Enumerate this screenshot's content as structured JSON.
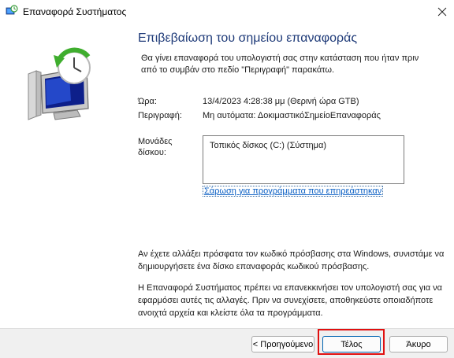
{
  "window": {
    "title": "Επαναφορά Συστήματος",
    "icon": "system-restore-icon",
    "close_glyph": "✕"
  },
  "main": {
    "heading": "Επιβεβαίωση του σημείου επαναφοράς",
    "intro": "Θα γίνει επαναφορά του υπολογιστή σας στην κατάσταση που ήταν πριν από το συμβάν στο πεδίο \"Περιγραφή\" παρακάτω.",
    "time_label": "Ώρα:",
    "time_value": "13/4/2023 4:28:38 μμ (Θερινή ώρα GTB)",
    "description_label": "Περιγραφή:",
    "description_value": "Μη αυτόματα: ΔοκιμαστικόΣημείοΕπαναφοράς",
    "drives_label": "Μονάδες δίσκου:",
    "drives": [
      "Τοπικός δίσκος (C:) (Σύστημα)"
    ],
    "scan_link": "Σάρωση για προγράμματα που επηρεάστηκαν",
    "password_note": "Αν έχετε αλλάξει πρόσφατα τον κωδικό πρόσβασης στα Windows, συνιστάμε να δημιουργήσετε ένα δίσκο επαναφοράς κωδικού πρόσβασης.",
    "restart_note": "Η Επαναφορά Συστήματος πρέπει να επανεκκινήσει τον υπολογιστή σας για να εφαρμόσει αυτές τις αλλαγές. Πριν να συνεχίσετε, αποθηκεύστε οποιαδήποτε ανοιχτά αρχεία και κλείστε όλα τα προγράμματα."
  },
  "footer": {
    "back_label": "< Προηγούμενο",
    "finish_label": "Τέλος",
    "cancel_label": "Άκυρο"
  },
  "colors": {
    "heading": "#1e3a78",
    "link": "#0a5fc4",
    "highlight": "#e01010"
  }
}
